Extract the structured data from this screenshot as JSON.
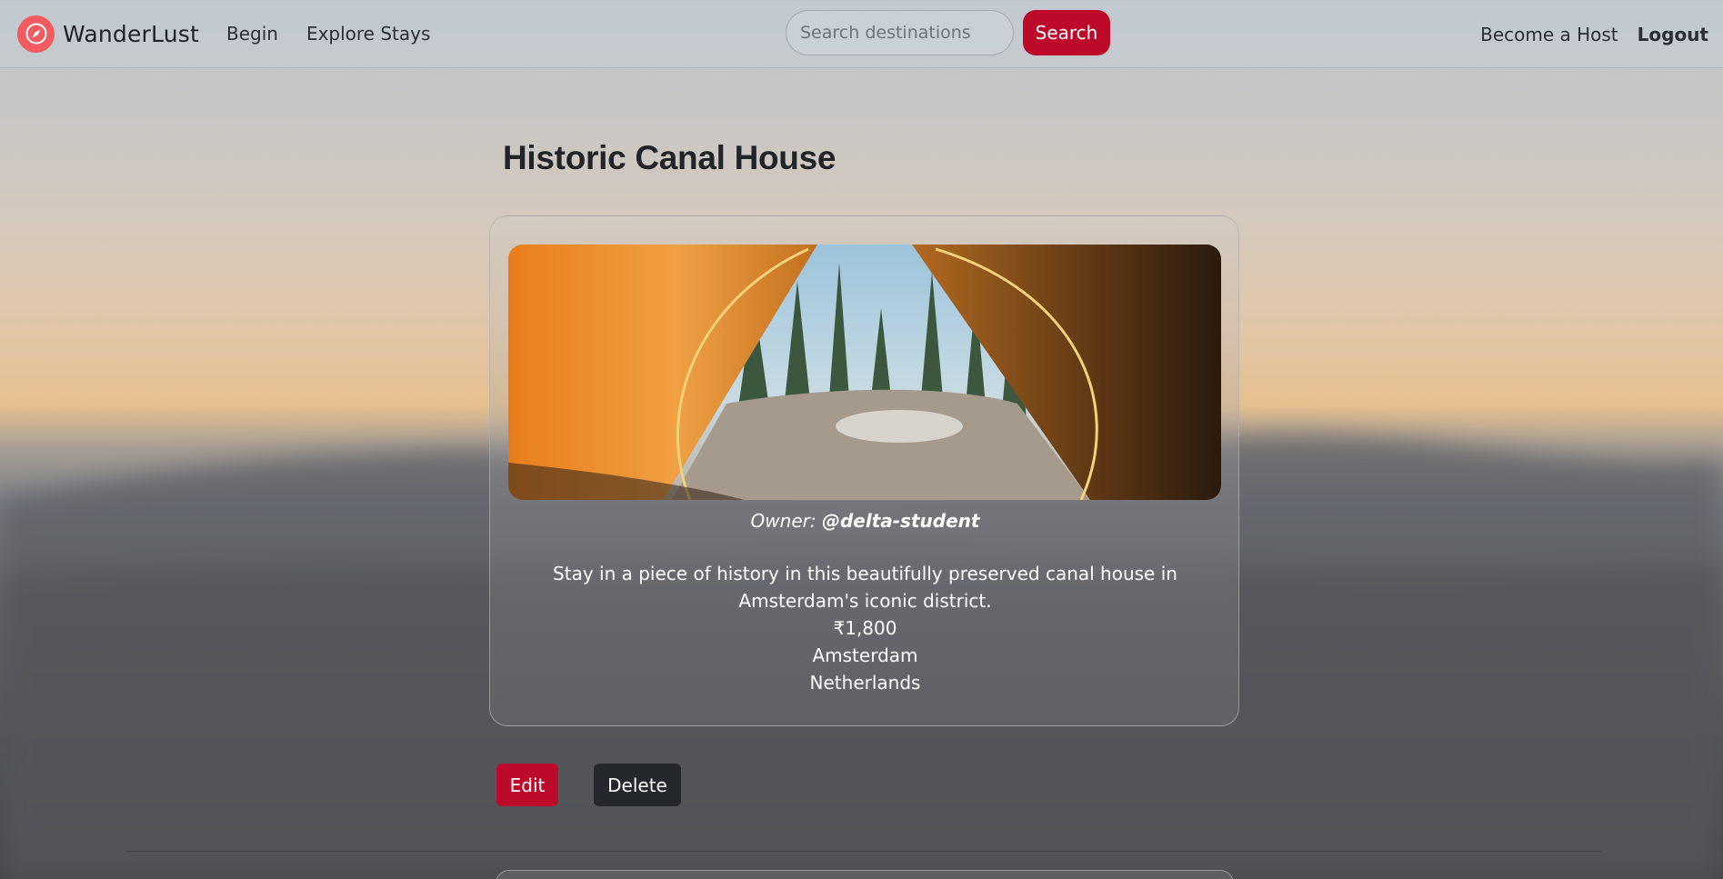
{
  "navbar": {
    "brand": "WanderLust",
    "links": [
      "Begin",
      "Explore Stays"
    ],
    "search_placeholder": "Search destinations",
    "search_button": "Search",
    "become_host": "Become a Host",
    "logout": "Logout"
  },
  "listing": {
    "title": "Historic Canal House",
    "owner_label": "Owner:",
    "owner": "@delta-student",
    "description": "Stay in a piece of history in this beautifully preserved canal house in Amsterdam's iconic district.",
    "price": "₹1,800",
    "city": "Amsterdam",
    "country": "Netherlands"
  },
  "actions": {
    "edit": "Edit",
    "delete": "Delete"
  },
  "colors": {
    "accent": "#be0a2a",
    "dark": "#24272b",
    "brand_icon": "#f25b5f"
  },
  "icons": {
    "brand": "compass-icon"
  }
}
